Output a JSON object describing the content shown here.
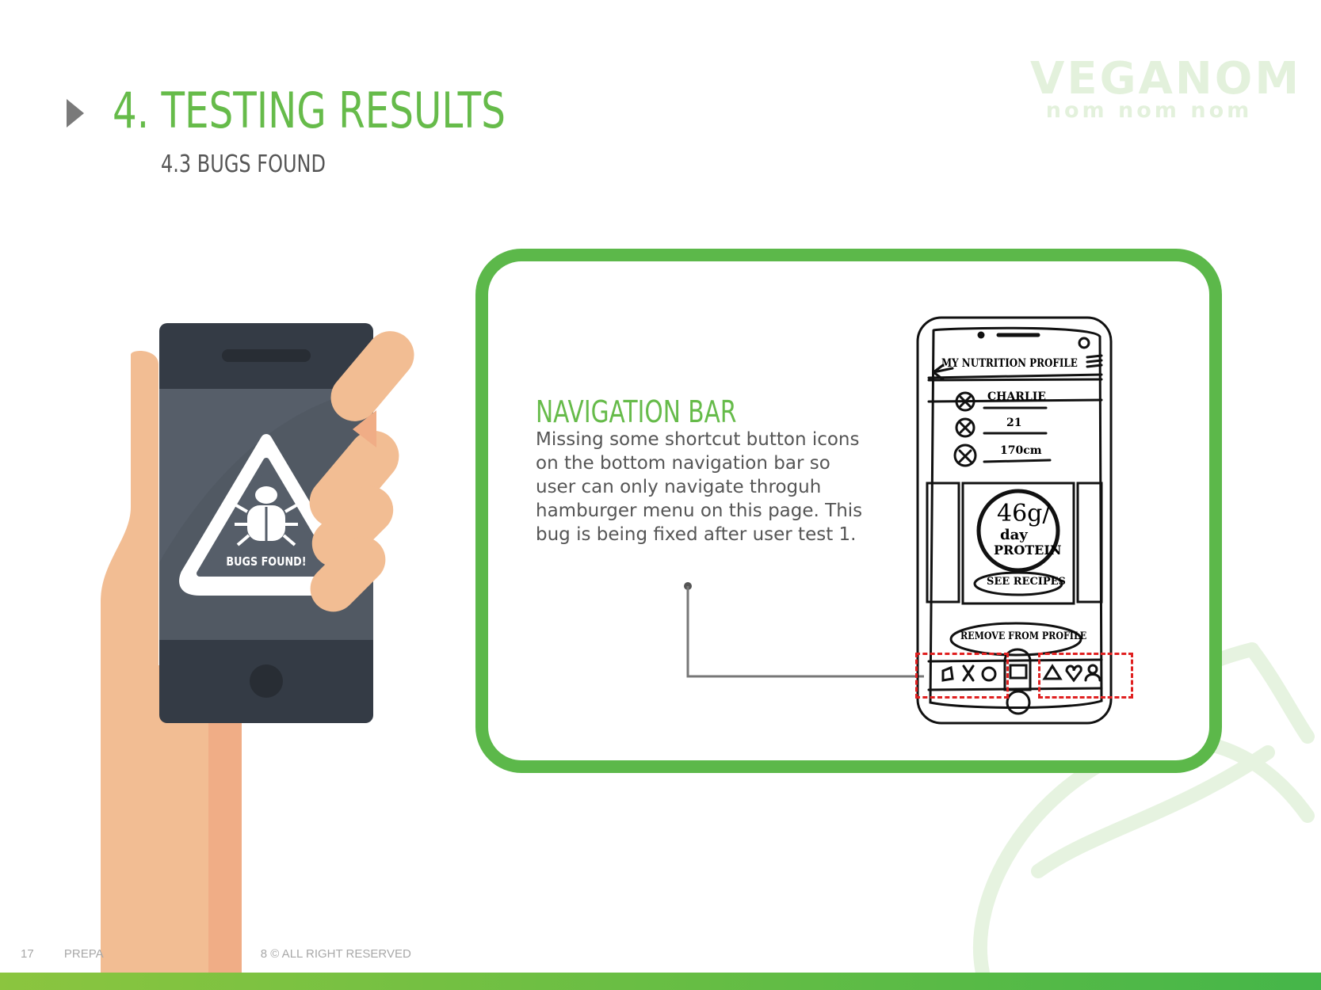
{
  "header": {
    "title": "4. TESTING RESULTS",
    "subtitle": "4.3  BUGS FOUND"
  },
  "logo": {
    "word": "VEGANOM",
    "tagline": "nom nom nom"
  },
  "illustration": {
    "badge_text": "BUGS FOUND!"
  },
  "card": {
    "heading": "NAVIGATION BAR",
    "body": "Missing some shortcut button icons\non the bottom navigation bar so\nuser  can only navigate throguh\nhamburger menu on this page. This\nbug is being fixed after user test 1."
  },
  "sketch": {
    "header": "MY NUTRITION PROFILE",
    "name": "CHARLIE",
    "age": "21",
    "height": "170cm",
    "metric_value": "46g/",
    "metric_unit": "day",
    "metric_label": "PROTEIN",
    "recipes_button": "SEE RECIPES",
    "remove_button": "REMOVE FROM PROFILE"
  },
  "footer": {
    "page_number": "17",
    "left_text": "PREPA",
    "right_text": "8  © ALL RIGHT RESERVED"
  },
  "colors": {
    "accent_green": "#66bb4a",
    "card_border": "#5cb84a",
    "highlight_red": "#e02020",
    "logo_faded": "#e3f1dc"
  }
}
